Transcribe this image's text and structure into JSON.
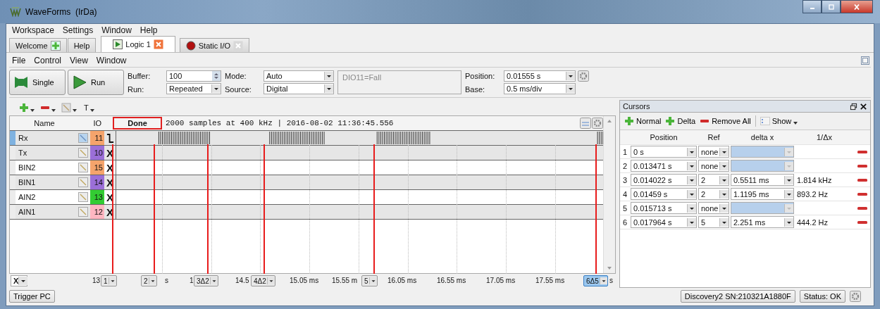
{
  "window": {
    "title": "WaveForms  (IrDa)"
  },
  "menu": [
    "Workspace",
    "Settings",
    "Window",
    "Help"
  ],
  "tabs": [
    {
      "label": "Welcome",
      "kind": "welcome",
      "closable": false,
      "selected": false
    },
    {
      "label": "Help",
      "kind": "help",
      "closable": false,
      "selected": false
    },
    {
      "label": "Logic 1",
      "kind": "logic",
      "closable": true,
      "selected": true
    },
    {
      "label": "Static I/O",
      "kind": "static",
      "closable": true,
      "selected": false
    }
  ],
  "submenu": [
    "File",
    "Control",
    "View",
    "Window"
  ],
  "toolbar": {
    "single": "Single",
    "run": "Run",
    "buffer": {
      "label": "Buffer:",
      "value": "100"
    },
    "run_mode": {
      "label": "Run:",
      "value": "Repeated"
    },
    "mode": {
      "label": "Mode:",
      "value": "Auto"
    },
    "source": {
      "label": "Source:",
      "value": "Digital"
    },
    "trigger_summary": "DIO11=Fall",
    "position": {
      "label": "Position:",
      "value": "0.01555 s"
    },
    "base": {
      "label": "Base:",
      "value": "0.5 ms/div"
    }
  },
  "logic": {
    "text_tool": "T",
    "header": {
      "name": "Name",
      "io": "IO",
      "status": "Done",
      "info": "2000 samples at 400 kHz | 2016-08-02 11:36:45.556"
    },
    "channels": [
      {
        "name": "Rx",
        "io": "11",
        "color": "#f5a46c",
        "selected": true,
        "trigger": {
          "kind": "fall"
        }
      },
      {
        "name": "Tx",
        "io": "10",
        "color": "#9b6fd8",
        "selected": false,
        "trigger": {
          "kind": "ignore",
          "text": "X"
        }
      },
      {
        "name": "BIN2",
        "io": "15",
        "color": "#f5a46c",
        "selected": false,
        "trigger": {
          "kind": "ignore",
          "text": "X"
        }
      },
      {
        "name": "BIN1",
        "io": "14",
        "color": "#9b6fd8",
        "selected": false,
        "trigger": {
          "kind": "ignore",
          "text": "X"
        }
      },
      {
        "name": "AIN2",
        "io": "13",
        "color": "#33cc33",
        "selected": false,
        "trigger": {
          "kind": "ignore",
          "text": "X"
        }
      },
      {
        "name": "AIN1",
        "io": "12",
        "color": "#ffb6c1",
        "selected": false,
        "trigger": {
          "kind": "ignore",
          "text": "X"
        }
      }
    ],
    "axis": {
      "selector": "X",
      "ticks": [
        "13",
        "s",
        "1",
        "14.5",
        "15.05 ms",
        "15.55 m",
        "16.05 ms",
        "16.55 ms",
        "17.05 ms",
        "17.55 ms",
        "s"
      ],
      "markers": [
        {
          "label": "1",
          "selected": false
        },
        {
          "label": "2",
          "selected": false
        },
        {
          "label": "3Δ2",
          "selected": false
        },
        {
          "label": "4Δ2",
          "selected": false
        },
        {
          "label": "5",
          "selected": false
        },
        {
          "label": "6Δ5",
          "selected": true
        }
      ]
    }
  },
  "cursors": {
    "title": "Cursors",
    "tools": {
      "normal": "Normal",
      "delta": "Delta",
      "remove_all": "Remove All",
      "show": "Show"
    },
    "columns": [
      "Position",
      "Ref",
      "delta x",
      "1/Δx"
    ],
    "rows": [
      {
        "index": "1",
        "position": "0 s",
        "ref": "none",
        "disabled": true
      },
      {
        "index": "2",
        "position": "0.013471 s",
        "ref": "none",
        "disabled": true
      },
      {
        "index": "3",
        "position": "0.014022 s",
        "ref": "2",
        "delta": "0.5511 ms",
        "inverse": "1.814 kHz",
        "disabled": false
      },
      {
        "index": "4",
        "position": "0.01459 s",
        "ref": "2",
        "delta": "1.1195 ms",
        "inverse": "893.2 Hz",
        "disabled": false
      },
      {
        "index": "5",
        "position": "0.015713 s",
        "ref": "none",
        "disabled": true
      },
      {
        "index": "6",
        "position": "0.017964 s",
        "ref": "5",
        "delta": "2.251 ms",
        "inverse": "444.2 Hz",
        "disabled": false
      }
    ]
  },
  "status_bar": {
    "trigger_button": "Trigger PC",
    "device": "Discovery2 SN:210321A1880F",
    "status": "Status: OK"
  }
}
